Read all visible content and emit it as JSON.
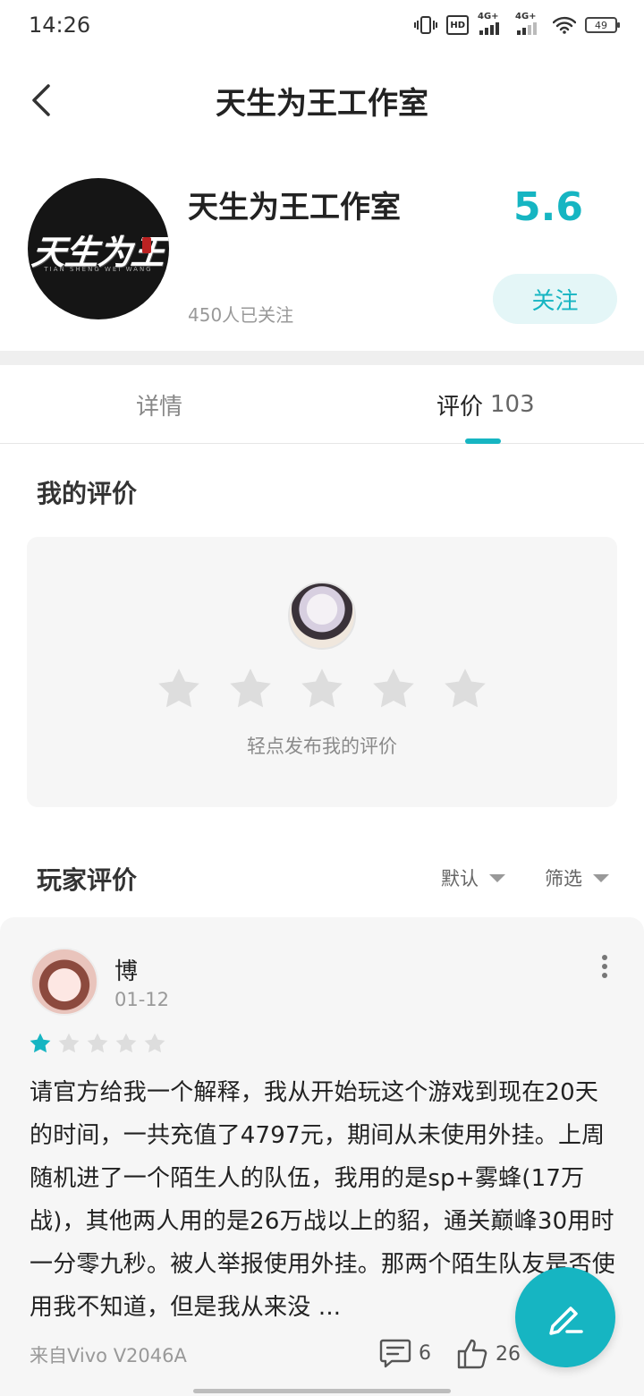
{
  "status_bar": {
    "time": "14:26",
    "battery": "49",
    "hd_label": "HD",
    "signal_1": "4G+",
    "signal_2": "4G+"
  },
  "header": {
    "title": "天生为王工作室"
  },
  "studio": {
    "name": "天生为王工作室",
    "logo_text": "天生为王",
    "logo_subtext": "TIAN SHENG WEI WANG",
    "followers": "450人已关注",
    "score": "5.6",
    "follow_label": "关注"
  },
  "tabs": [
    {
      "label": "详情",
      "active": false
    },
    {
      "label": "评价",
      "count": "103",
      "active": true
    }
  ],
  "my_review": {
    "title": "我的评价",
    "hint": "轻点发布我的评价",
    "stars_total": 5
  },
  "player_reviews": {
    "title": "玩家评价",
    "sort_label": "默认",
    "filter_label": "筛选"
  },
  "review": {
    "user": "博",
    "date": "01-12",
    "rating": 1,
    "rating_max": 5,
    "body": "请官方给我一个解释，我从开始玩这个游戏到现在20天的时间，一共充值了4797元，期间从未使用外挂。上周随机进了一个陌生人的队伍，我用的是sp+雾蜂(17万战)，其他两人用的是26万战以上的貂，通关巅峰30用时一分零九秒。被人举报使用外挂。那两个陌生队友是否使用我不知道，但是我从来没 ...",
    "device": "来自Vivo V2046A",
    "comments": "6",
    "likes": "26"
  },
  "colors": {
    "accent": "#16b5c2",
    "star_active": "#16b5c2",
    "star_inactive": "#dddddd"
  },
  "icons": [
    "back-icon",
    "comment-icon",
    "like-icon",
    "edit-icon",
    "more-icon",
    "star-icon",
    "vibrate-icon",
    "wifi-icon",
    "battery-icon"
  ]
}
